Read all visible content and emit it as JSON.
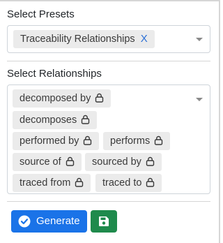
{
  "presets": {
    "label": "Select Presets",
    "chips": [
      {
        "text": "Traceability Relationships",
        "remove": "X"
      }
    ]
  },
  "relationships": {
    "label": "Select Relationships",
    "chips": [
      {
        "text": "decomposed by"
      },
      {
        "text": "decomposes"
      },
      {
        "text": "performed by"
      },
      {
        "text": "performs"
      },
      {
        "text": "source of"
      },
      {
        "text": "sourced by"
      },
      {
        "text": "traced from"
      },
      {
        "text": "traced to"
      }
    ]
  },
  "actions": {
    "generate_label": "Generate",
    "generate_icon": "check-circle-icon",
    "save_icon": "floppy-disk-icon"
  },
  "colors": {
    "primary": "#1a73e8",
    "success": "#1f8a4c",
    "chip_bg": "#ebebeb",
    "remove_x": "#2b6fd6"
  }
}
